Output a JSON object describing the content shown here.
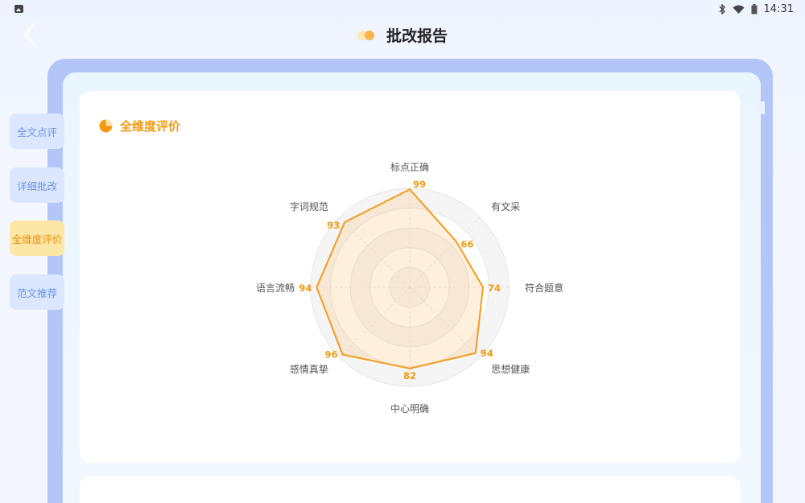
{
  "status_bar": {
    "time": "14:31"
  },
  "header": {
    "title": "批改报告"
  },
  "sidebar": {
    "tabs": [
      {
        "label": "全文点评",
        "active": false
      },
      {
        "label": "详细批改",
        "active": false
      },
      {
        "label": "全维度评价",
        "active": true
      },
      {
        "label": "范文推荐",
        "active": false
      }
    ]
  },
  "section": {
    "title": "全维度评价"
  },
  "colors": {
    "accent": "#f39a12",
    "tab_inactive": "#dbe7fc",
    "tab_active": "#fde7a6",
    "frame": "#b3c6f7"
  },
  "chart_data": {
    "type": "radar",
    "max": 100,
    "axes": [
      "标点正确",
      "有文采",
      "符合题意",
      "思想健康",
      "中心明确",
      "感情真挚",
      "语言流畅",
      "字词规范"
    ],
    "values": [
      99,
      66,
      74,
      94,
      82,
      96,
      94,
      93
    ]
  }
}
